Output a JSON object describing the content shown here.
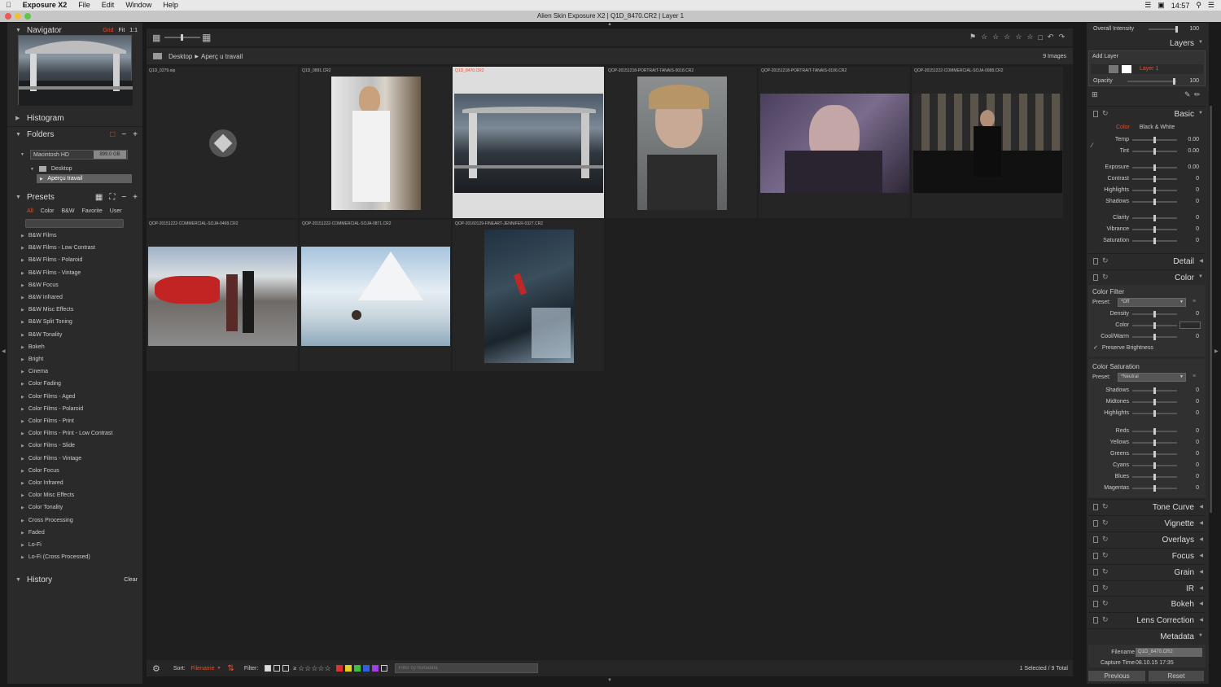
{
  "menubar": {
    "app": "Exposure X2",
    "items": [
      "File",
      "Edit",
      "Window",
      "Help"
    ],
    "clock": "14:57"
  },
  "window": {
    "title": "Alien Skin Exposure X2 | Q1D_8470.CR2 | Layer 1"
  },
  "left": {
    "navigator": {
      "title": "Navigator",
      "modes": [
        "Grid",
        "Fit",
        "1:1"
      ],
      "active_mode": "Grid"
    },
    "histogram": {
      "title": "Histogram"
    },
    "folders": {
      "title": "Folders",
      "drive": {
        "name": "Macintosh HD",
        "size": "899.0 GB"
      },
      "items": [
        "Desktop",
        "Aperçu travail"
      ]
    },
    "presets": {
      "title": "Presets",
      "tabs": [
        "All",
        "Color",
        "B&W",
        "Favorite",
        "User"
      ],
      "active_tab": "All",
      "items": [
        "B&W Films",
        "B&W Films - Low Contrast",
        "B&W Films - Polaroid",
        "B&W Films - Vintage",
        "B&W Focus",
        "B&W Infrared",
        "B&W Misc Effects",
        "B&W Split Toning",
        "B&W Tonality",
        "Bokeh",
        "Bright",
        "Cinema",
        "Color Fading",
        "Color Films - Aged",
        "Color Films - Polaroid",
        "Color Films - Print",
        "Color Films - Print - Low Contrast",
        "Color Films - Slide",
        "Color Films - Vintage",
        "Color Focus",
        "Color Infrared",
        "Color Misc Effects",
        "Color Tonality",
        "Cross Processing",
        "Faded",
        "Lo-Fi",
        "Lo-Fi (Cross Processed)"
      ]
    },
    "history": {
      "title": "History",
      "clear": "Clear"
    }
  },
  "center": {
    "breadcrumb": [
      "Desktop",
      "Aperç u travail"
    ],
    "image_count": "9 Images",
    "thumbs": [
      {
        "name": "Q1D_0279.eip",
        "kind": "placeholder"
      },
      {
        "name": "Q1D_0891.CR2",
        "kind": "portrait-window"
      },
      {
        "name": "Q1D_8470.CR2",
        "kind": "dancer",
        "selected": true
      },
      {
        "name": "QOP-20151218-PORTRAIT-TANAIS-0018.CR2",
        "kind": "portrait-blonde"
      },
      {
        "name": "QOP-20151218-PORTRAIT-TANAIS-0106.CR2",
        "kind": "portrait-purple"
      },
      {
        "name": "QOP-20151222-COMMERCIAL-SOJA-0088.CR2",
        "kind": "woman-sofa"
      },
      {
        "name": "QOP-20151222-COMMERCIAL-SOJA-0468.CR2",
        "kind": "helicopter"
      },
      {
        "name": "QOP-20151222-COMMERCIAL-SOJA-0871.CR2",
        "kind": "mountain-pool"
      },
      {
        "name": "QOP-20160129-FINEART-JENNIFER-0327.CR2",
        "kind": "waterfall"
      }
    ],
    "bottom": {
      "sort_label": "Sort:",
      "sort_value": "Filename",
      "filter_label": "Filter:",
      "filter_placeholder": "Filter by metadata",
      "status": "1 Selected / 9 Total",
      "colors": [
        "#e03030",
        "#e6d020",
        "#40c040",
        "#3060e0",
        "#a040e0"
      ]
    }
  },
  "right": {
    "overall_intensity": {
      "label": "Overall Intensity",
      "value": "100"
    },
    "layers": {
      "title": "Layers",
      "add": "Add Layer",
      "layer_name": "Layer 1",
      "opacity_label": "Opacity",
      "opacity_value": "100"
    },
    "basic": {
      "title": "Basic",
      "modes": [
        "Color",
        "Black & White"
      ],
      "rows": [
        {
          "label": "Temp",
          "value": "0.00"
        },
        {
          "label": "Tint",
          "value": "0.00"
        },
        {
          "label": "Exposure",
          "value": "0.00"
        },
        {
          "label": "Contrast",
          "value": "0"
        },
        {
          "label": "Highlights",
          "value": "0"
        },
        {
          "label": "Shadows",
          "value": "0"
        },
        {
          "label": "Clarity",
          "value": "0"
        },
        {
          "label": "Vibrance",
          "value": "0"
        },
        {
          "label": "Saturation",
          "value": "0"
        }
      ]
    },
    "detail": {
      "title": "Detail"
    },
    "color": {
      "title": "Color",
      "filter": {
        "title": "Color Filter",
        "preset_label": "Preset:",
        "preset_value": "*Off",
        "rows": [
          {
            "label": "Density",
            "value": "0"
          },
          {
            "label": "Color",
            "value": ""
          },
          {
            "label": "Cool/Warm",
            "value": "0"
          }
        ],
        "preserve": "Preserve Brightness"
      },
      "saturation": {
        "title": "Color Saturation",
        "preset_label": "Preset:",
        "preset_value": "*Neutral",
        "rows": [
          {
            "label": "Shadows",
            "value": "0"
          },
          {
            "label": "Midtones",
            "value": "0"
          },
          {
            "label": "Highlights",
            "value": "0"
          },
          {
            "label": "Reds",
            "value": "0"
          },
          {
            "label": "Yellows",
            "value": "0"
          },
          {
            "label": "Greens",
            "value": "0"
          },
          {
            "label": "Cyans",
            "value": "0"
          },
          {
            "label": "Blues",
            "value": "0"
          },
          {
            "label": "Magentas",
            "value": "0"
          }
        ]
      }
    },
    "panels": [
      "Tone Curve",
      "Vignette",
      "Overlays",
      "Focus",
      "Grain",
      "IR",
      "Bokeh",
      "Lens Correction"
    ],
    "metadata": {
      "title": "Metadata",
      "filename_label": "Filename",
      "filename_value": "Q1D_8470.CR2",
      "capture_label": "Capture Time",
      "capture_value": "08.10.15 17:35"
    },
    "buttons": {
      "previous": "Previous",
      "reset": "Reset"
    }
  },
  "colors": {
    "accent": "#e05030",
    "selected_layer": "#e05030"
  }
}
